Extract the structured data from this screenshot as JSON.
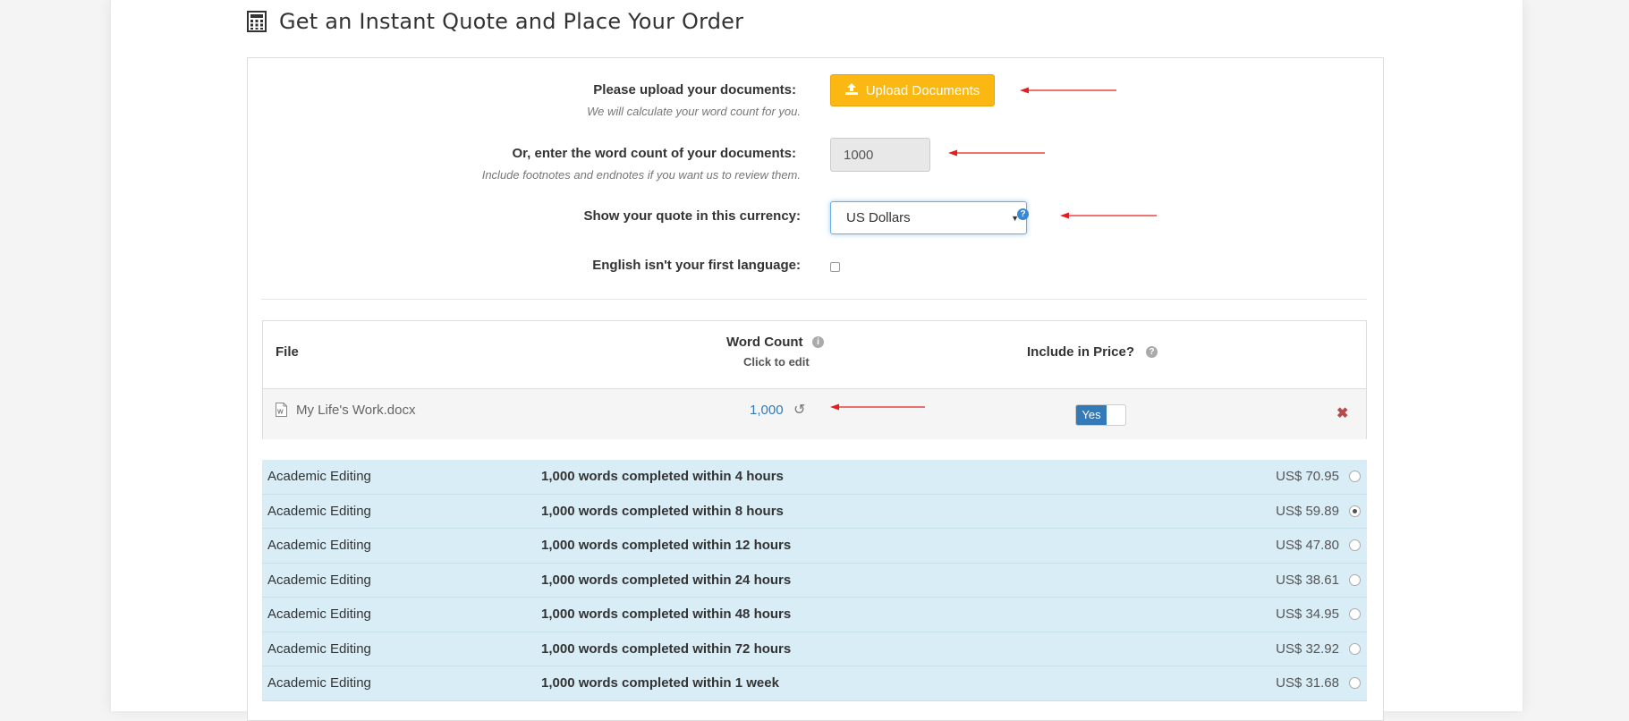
{
  "page": {
    "title": "Get an Instant Quote and Place Your Order",
    "title_icon": "calculator-icon"
  },
  "form": {
    "upload_label": "Please upload your documents:",
    "upload_hint": "We will calculate your word count for you.",
    "upload_button": "Upload Documents",
    "wordcount_label": "Or, enter the word count of your documents:",
    "wordcount_hint": "Include footnotes and endnotes if you want us to review them.",
    "wordcount_value": "1000",
    "currency_label": "Show your quote in this currency:",
    "currency_selected": "US Dollars",
    "esl_label": "English isn't your first language:",
    "esl_checked": false
  },
  "file_table": {
    "col_file": "File",
    "col_wordcount": "Word Count",
    "col_wordcount_sub": "Click to edit",
    "col_include": "Include in Price?",
    "rows": [
      {
        "name": "My Life's Work.docx",
        "word_count": "1,000",
        "include": "Yes"
      }
    ]
  },
  "services": [
    {
      "service": "Academic Editing",
      "description": "1,000 words completed within 4 hours",
      "price": "US$ 70.95",
      "selected": false
    },
    {
      "service": "Academic Editing",
      "description": "1,000 words completed within 8 hours",
      "price": "US$ 59.89",
      "selected": true
    },
    {
      "service": "Academic Editing",
      "description": "1,000 words completed within 12 hours",
      "price": "US$ 47.80",
      "selected": false
    },
    {
      "service": "Academic Editing",
      "description": "1,000 words completed within 24 hours",
      "price": "US$ 38.61",
      "selected": false
    },
    {
      "service": "Academic Editing",
      "description": "1,000 words completed within 48 hours",
      "price": "US$ 34.95",
      "selected": false
    },
    {
      "service": "Academic Editing",
      "description": "1,000 words completed within 72 hours",
      "price": "US$ 32.92",
      "selected": false
    },
    {
      "service": "Academic Editing",
      "description": "1,000 words completed within 1 week",
      "price": "US$ 31.68",
      "selected": false
    }
  ],
  "colors": {
    "accent_button": "#fbb813",
    "toggle_on": "#337ab7",
    "row_highlight": "#d9edf7",
    "annotation_arrow": "#e0201e",
    "remove": "#b94a48"
  }
}
